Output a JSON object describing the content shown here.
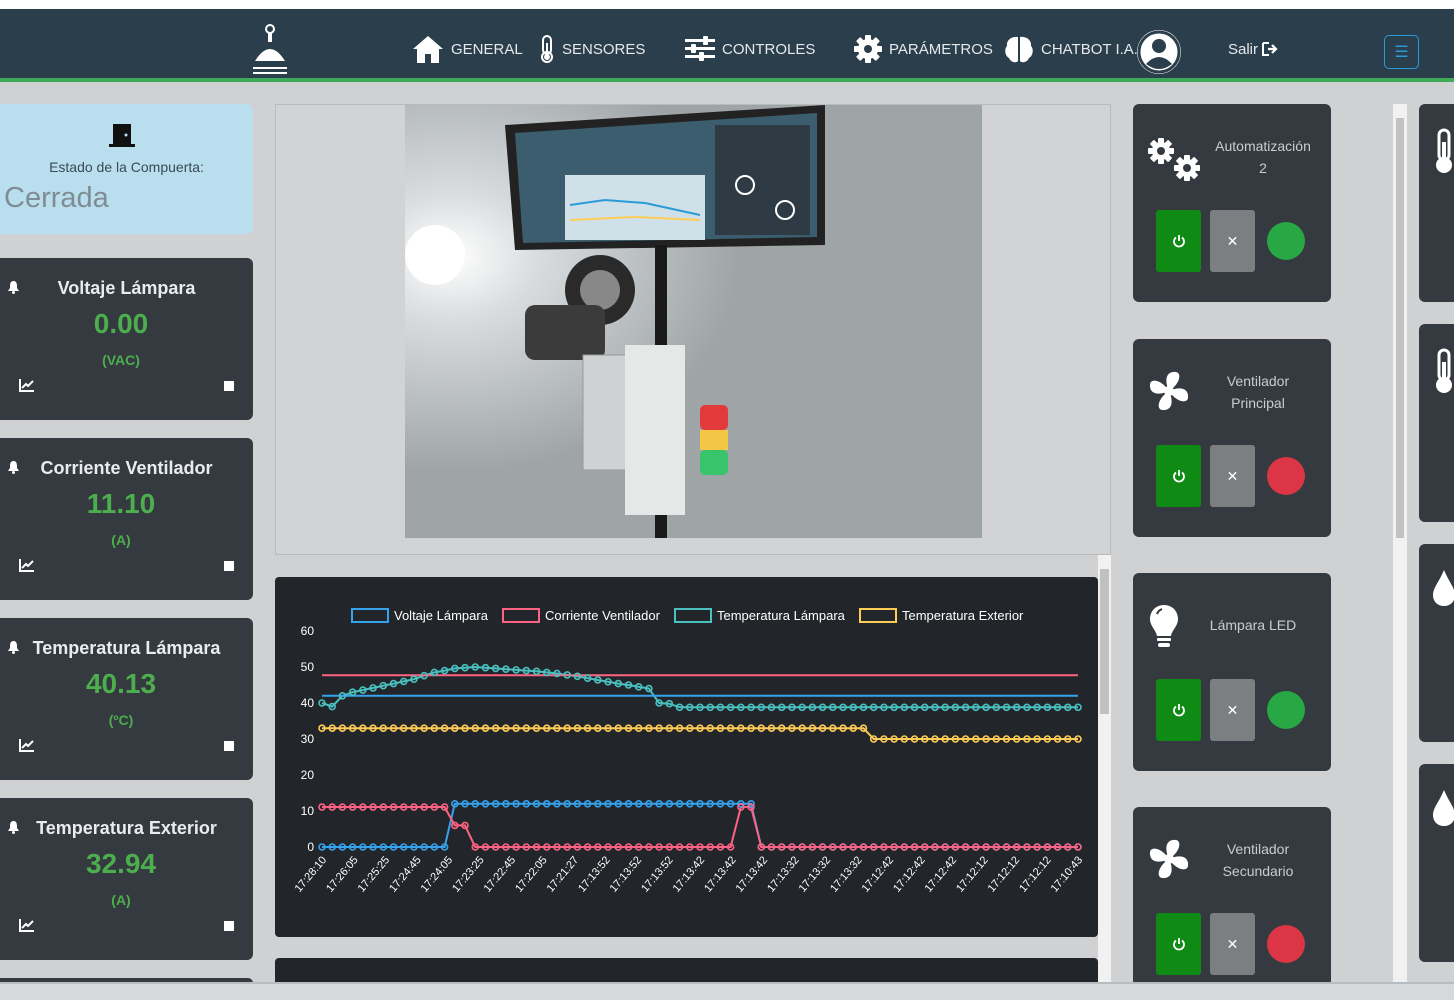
{
  "nav": {
    "items": [
      {
        "label": "GENERAL",
        "icon": "home-icon"
      },
      {
        "label": "SENSORES",
        "icon": "thermometer-icon"
      },
      {
        "label": "CONTROLES",
        "icon": "sliders-icon"
      },
      {
        "label": "PARÁMETROS",
        "icon": "gear-icon"
      },
      {
        "label": "CHATBOT I.A.",
        "icon": "brain-icon"
      }
    ],
    "logout_label": "Salir",
    "menu_glyph": "☰"
  },
  "gate": {
    "label": "Estado de la Compuerta:",
    "value": "Cerrada"
  },
  "sensors": [
    {
      "title": "Voltaje Lámpara",
      "value": "0.00",
      "unit": "(VAC)"
    },
    {
      "title": "Corriente Ventilador",
      "value": "11.10",
      "unit": "(A)"
    },
    {
      "title": "Temperatura Lámpara",
      "value": "40.13",
      "unit": "(ºC)"
    },
    {
      "title": "Temperatura Exterior",
      "value": "32.94",
      "unit": "(A)"
    }
  ],
  "controls": [
    {
      "label_line1": "Automatización",
      "label_line2": "2",
      "icon": "gears-icon",
      "status": "on",
      "status_color": "#28a745",
      "off_glyph": "✕"
    },
    {
      "label_line1": "Ventilador",
      "label_line2": "Principal",
      "icon": "fan-icon",
      "status": "off",
      "status_color": "#dc3545",
      "off_glyph": "✕"
    },
    {
      "label_line1": "Lámpara LED",
      "label_line2": "",
      "icon": "lightbulb-icon",
      "status": "on",
      "status_color": "#28a745",
      "off_glyph": "✕"
    },
    {
      "label_line1": "Ventilador",
      "label_line2": "Secundario",
      "icon": "fan-icon",
      "status": "off",
      "status_color": "#dc3545",
      "off_glyph": "✕"
    }
  ],
  "chart_data": {
    "type": "line",
    "ylim": [
      0,
      60
    ],
    "yticks": [
      0,
      10,
      20,
      30,
      40,
      50,
      60
    ],
    "x_tick_labels": [
      "17:28:10",
      "17:26:05",
      "17:25:25",
      "17:24:45",
      "17:24:05",
      "17:23:25",
      "17:22:45",
      "17:22:05",
      "17:21:27",
      "17:13:52",
      "17:13:52",
      "17:13:52",
      "17:13:42",
      "17:13:42",
      "17:13:42",
      "17:13:32",
      "17:13:32",
      "17:13:32",
      "17:12:42",
      "17:12:42",
      "17:12:42",
      "17:12:12",
      "17:12:12",
      "17:12:12",
      "17:10:43"
    ],
    "n_points": 75,
    "series": [
      {
        "name": "Voltaje Lámpara",
        "color": "#36a2eb",
        "segments": [
          [
            0,
            13,
            0
          ],
          [
            13,
            43,
            12
          ],
          [
            43,
            75,
            0
          ]
        ]
      },
      {
        "name": "Corriente Ventilador",
        "color": "#ff6384",
        "segments": [
          [
            0,
            13,
            11.1
          ],
          [
            13,
            15,
            6
          ],
          [
            15,
            41,
            0
          ],
          [
            41,
            43,
            11.1
          ],
          [
            43,
            75,
            0
          ]
        ]
      },
      {
        "name": "Temperatura Lámpara",
        "color": "#4bc0c0",
        "values": [
          40,
          39,
          42,
          43,
          43.6,
          44.2,
          44.8,
          45.4,
          46,
          46.6,
          47.6,
          48.5,
          49,
          49.6,
          49.8,
          50,
          49.8,
          49.6,
          49.4,
          49.2,
          49,
          48.8,
          48.5,
          48.2,
          47.8,
          47.4,
          46.9,
          46.4,
          45.9,
          45.4,
          45,
          44.5,
          44,
          40,
          39.8,
          38.8,
          38.8,
          38.8,
          38.8,
          38.8,
          38.8,
          38.8,
          38.8,
          38.8,
          38.8,
          38.8,
          38.8,
          38.8,
          38.8,
          38.8,
          38.8,
          38.8,
          38.8,
          38.8,
          38.8,
          38.8,
          38.8,
          38.8,
          38.8,
          38.8,
          38.8,
          38.8,
          38.8,
          38.8,
          38.8,
          38.8,
          38.8,
          38.8,
          38.8,
          38.8,
          38.8,
          38.8,
          38.8,
          38.8,
          38.8
        ]
      },
      {
        "name": "Temperatura Exterior",
        "color": "#ffcd56",
        "segments": [
          [
            0,
            54,
            33
          ],
          [
            54,
            75,
            30
          ]
        ]
      },
      {
        "name": "",
        "color": "#ff6384",
        "constant": 47.7,
        "no_points": true
      },
      {
        "name": "",
        "color": "#36a2eb",
        "constant": 42.0,
        "no_points": true
      }
    ]
  }
}
